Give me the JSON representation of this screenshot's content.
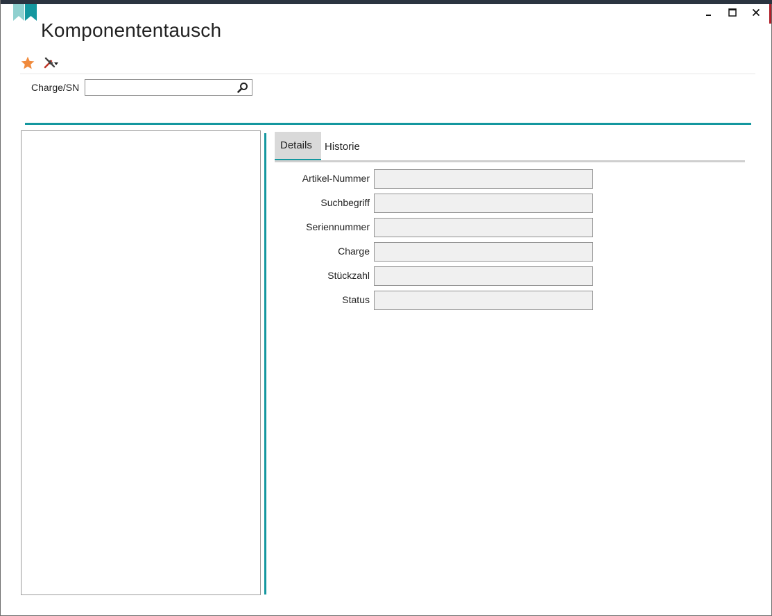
{
  "window": {
    "title": "Komponententausch",
    "controls": {
      "minimize_icon": "minimize-icon",
      "maximize_icon": "maximize-icon",
      "close_icon": "close-icon"
    }
  },
  "toolbar": {
    "favorite_icon": "star-icon",
    "tools_icon": "tools-icon"
  },
  "search": {
    "label": "Charge/SN",
    "value": "",
    "placeholder": "",
    "button_icon": "search-icon"
  },
  "tabs": [
    {
      "label": "Details",
      "active": true
    },
    {
      "label": "Historie",
      "active": false
    }
  ],
  "details": {
    "fields": [
      {
        "label": "Artikel-Nummer",
        "value": ""
      },
      {
        "label": "Suchbegriff",
        "value": ""
      },
      {
        "label": "Seriennummer",
        "value": ""
      },
      {
        "label": "Charge",
        "value": ""
      },
      {
        "label": "Stückzahl",
        "value": ""
      },
      {
        "label": "Status",
        "value": ""
      }
    ]
  },
  "colors": {
    "accent": "#14979f",
    "star": "#f08a3c",
    "bookmark": "#8fd0cf",
    "titlebar": "#2b3440"
  }
}
